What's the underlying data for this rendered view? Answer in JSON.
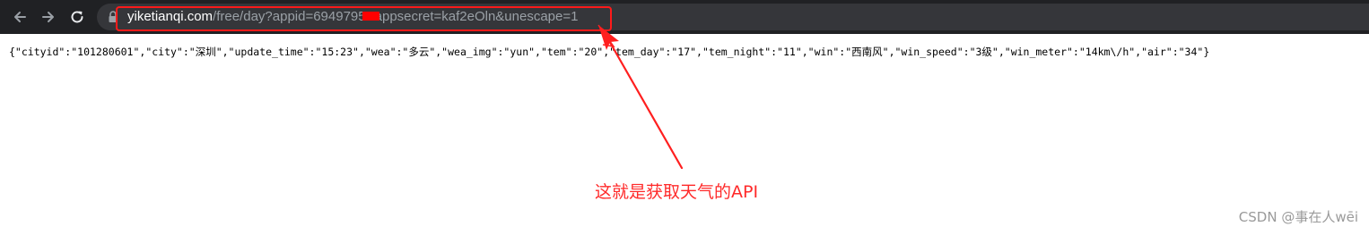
{
  "browser": {
    "url_host": "yiketianqi.com",
    "url_path": "/free/day?appid=6949795",
    "url_rest": "&appsecret=kaf2eOln&unescape=1"
  },
  "page": {
    "json_text": "{\"cityid\":\"101280601\",\"city\":\"深圳\",\"update_time\":\"15:23\",\"wea\":\"多云\",\"wea_img\":\"yun\",\"tem\":\"20\",\"tem_day\":\"17\",\"tem_night\":\"11\",\"win\":\"西南风\",\"win_speed\":\"3级\",\"win_meter\":\"14km\\/h\",\"air\":\"34\"}"
  },
  "annotation": {
    "text": "这就是获取天气的API",
    "color": "#ff2a2a"
  },
  "watermark": {
    "text": "CSDN @事在人wēi"
  },
  "icons": {
    "back": "back-arrow-icon",
    "forward": "forward-arrow-icon",
    "reload": "reload-icon",
    "lock": "lock-icon"
  }
}
